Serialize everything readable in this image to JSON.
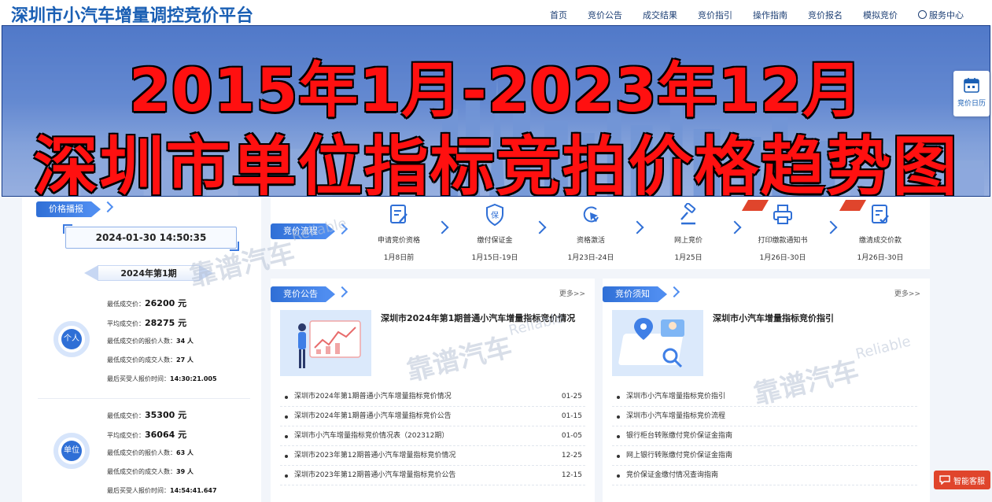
{
  "site": {
    "title": "深圳市小汽车增量调控竞价平台",
    "nav": [
      "首页",
      "竞价公告",
      "成交结果",
      "竞价指引",
      "操作指南",
      "竞价报名",
      "模拟竞价",
      "服务中心"
    ]
  },
  "banner": {
    "headline_line1": "2015年1月-2023年12月",
    "headline_line2": "深圳市单位指标竞拍价格趋势图"
  },
  "side_widgets": {
    "calendar_label": "竞价日历",
    "chat_label": "智能客服"
  },
  "price_panel": {
    "tab_label": "价格播报",
    "timestamp": "2024-01-30 14:50:35",
    "period": "2024年第1期",
    "personal": {
      "badge": "个人",
      "min_price_label": "最低成交价：",
      "min_price": "26200 元",
      "avg_price_label": "平均成交价：",
      "avg_price": "28275 元",
      "min_bidders_label": "最低成交价的报价人数：",
      "min_bidders": "34 人",
      "min_deals_label": "最低成交价的成交人数：",
      "min_deals": "27 人",
      "last_bid_label": "最后买受人报价时间：",
      "last_bid_time": "14:30:21.005"
    },
    "unit": {
      "badge": "单位",
      "min_price_label": "最低成交价：",
      "min_price": "35300 元",
      "avg_price_label": "平均成交价：",
      "avg_price": "36064 元",
      "min_bidders_label": "最低成交价的报价人数：",
      "min_bidders": "63 人",
      "min_deals_label": "最低成交价的成交人数：",
      "min_deals": "39 人",
      "last_bid_label": "最后买受人报价时间：",
      "last_bid_time": "14:54:41.647"
    }
  },
  "process": {
    "tab_label": "竞价流程",
    "steps": [
      {
        "title": "申请竞价资格",
        "date": "1月8日前"
      },
      {
        "title": "缴付保证金",
        "date": "1月15日-19日"
      },
      {
        "title": "资格激活",
        "date": "1月23日-24日"
      },
      {
        "title": "网上竞价",
        "date": "1月25日"
      },
      {
        "title": "打印缴款通知书",
        "date": "1月26日-30日"
      },
      {
        "title": "缴清成交价款",
        "date": "1月26日-30日"
      }
    ]
  },
  "announcements": {
    "tab_label": "竞价公告",
    "more": "更多>>",
    "feature_title": "深圳市2024年第1期普通小汽车增量指标竞价情况",
    "items": [
      {
        "title": "深圳市2024年第1期普通小汽车增量指标竞价情况",
        "date": "01-25"
      },
      {
        "title": "深圳市2024年第1期普通小汽车增量指标竞价公告",
        "date": "01-15"
      },
      {
        "title": "深圳市小汽车增量指标竞价情况表（202312期）",
        "date": "01-05"
      },
      {
        "title": "深圳市2023年第12期普通小汽车增量指标竞价情况",
        "date": "12-25"
      },
      {
        "title": "深圳市2023年第12期普通小汽车增量指标竞价公告",
        "date": "12-15"
      }
    ]
  },
  "guides": {
    "tab_label": "竞价须知",
    "more": "更多>>",
    "feature_title": "深圳市小汽车增量指标竞价指引",
    "items": [
      {
        "title": "深圳市小汽车增量指标竞价指引"
      },
      {
        "title": "深圳市小汽车增量指标竞价流程"
      },
      {
        "title": "银行柜台转账缴付竞价保证金指南"
      },
      {
        "title": "网上银行转账缴付竞价保证金指南"
      },
      {
        "title": "竞价保证金缴付情况查询指南"
      }
    ]
  },
  "watermark": {
    "cn": "靠谱汽车",
    "en": "Reliable"
  },
  "colors": {
    "brand": "#1a5fb4",
    "accent": "#2f6fd6",
    "headline": "#ff1010",
    "chat": "#e0452c"
  }
}
